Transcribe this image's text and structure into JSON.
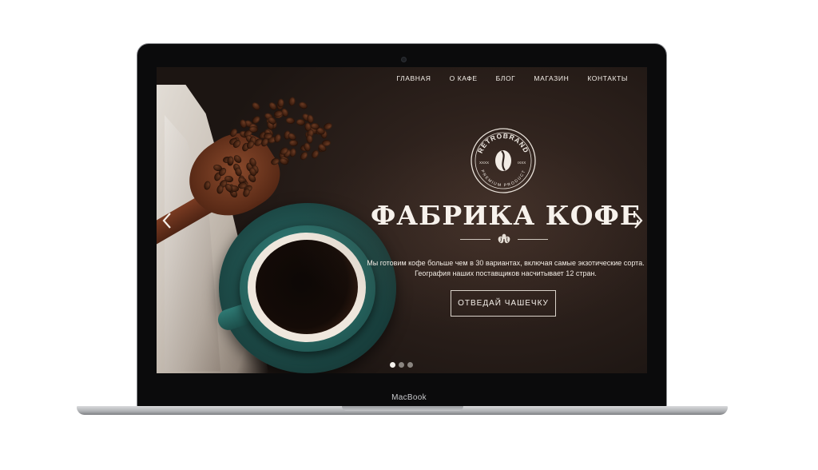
{
  "device": {
    "label": "MacBook"
  },
  "nav": {
    "items": [
      {
        "label": "ГЛАВНАЯ"
      },
      {
        "label": "О КАФЕ"
      },
      {
        "label": "БЛОГ"
      },
      {
        "label": "МАГАЗИН"
      },
      {
        "label": "КОНТАКТЫ"
      }
    ]
  },
  "logo": {
    "ring_top": "RETROBRAND",
    "ring_bottom": "PREMIUM PRODUCT",
    "side_left": "XXXX",
    "side_right": "IXXX"
  },
  "hero": {
    "title": "ФАБРИКА КОФЕ",
    "text_line1": "Мы готовим кофе больше чем в 30 вариантах, включая самые экзотические сорта.",
    "text_line2": "География наших поставщиков насчитывает 12 стран.",
    "cta_label": "ОТВЕДАЙ ЧАШЕЧКУ"
  },
  "slider": {
    "prev_icon": "chevron-left-icon",
    "next_icon": "chevron-right-icon",
    "slide_count": 3,
    "active_index": 0
  },
  "colors": {
    "background": "#2d211c",
    "text": "#f4efe9",
    "cup": "#1f4f4c"
  }
}
